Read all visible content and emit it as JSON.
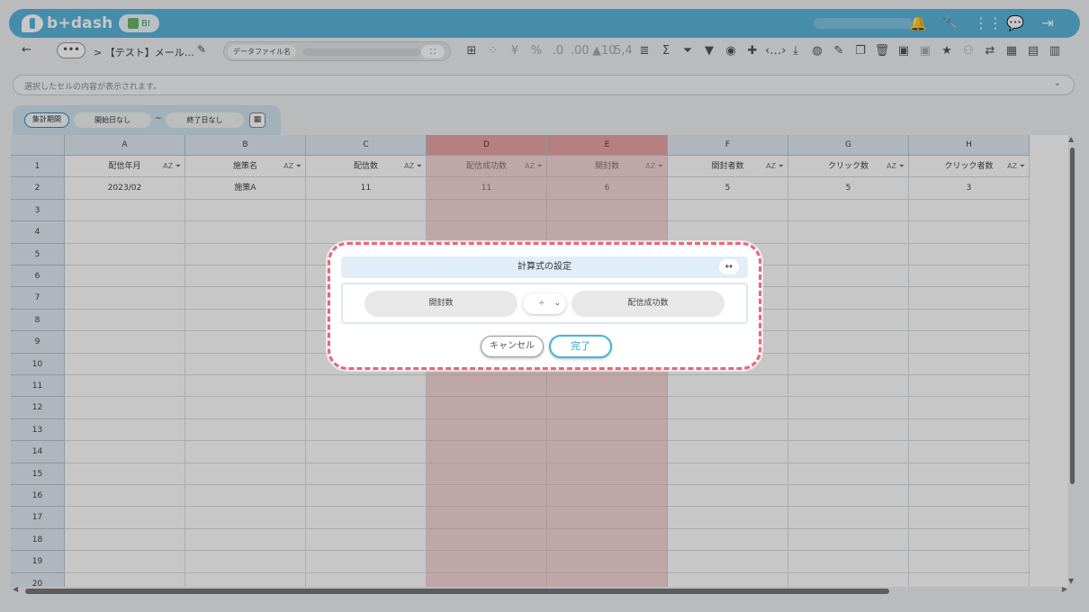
{
  "header": {
    "logo_text": "b+dash",
    "badge_text": "BI",
    "icons": [
      "bell-icon",
      "wrench-icon",
      "apps-grid-icon",
      "chat-icon",
      "logout-icon"
    ]
  },
  "toolbar": {
    "back_icon": "←",
    "more_label": "•••",
    "breadcrumb": "> 【テスト】メール…",
    "edit_icon": "✎",
    "datafile_label": "データファイル名",
    "expand_label": "⛶",
    "tool_icons": [
      {
        "name": "table-icon",
        "glyph": "⊞",
        "dim": false
      },
      {
        "name": "dotted-grid-icon",
        "glyph": "⁘",
        "dim": true
      },
      {
        "name": "yen-icon",
        "glyph": "¥",
        "dim": true
      },
      {
        "name": "percent-icon",
        "glyph": "%",
        "dim": true
      },
      {
        "name": "decimal-decrease-icon",
        "glyph": ".0",
        "dim": true
      },
      {
        "name": "decimal-increase-icon",
        "glyph": ".00",
        "dim": true
      },
      {
        "name": "sort-number-icon",
        "glyph": "▲10",
        "dim": true
      },
      {
        "name": "format-number-icon",
        "glyph": "5,4",
        "dim": true
      },
      {
        "name": "align-icon",
        "glyph": "≣",
        "dim": false
      },
      {
        "name": "sum-icon",
        "glyph": "Σ",
        "dim": false
      },
      {
        "name": "filter-clear-icon",
        "glyph": "⏷",
        "dim": false
      },
      {
        "name": "filter-icon",
        "glyph": "▼",
        "dim": false
      },
      {
        "name": "eye-icon",
        "glyph": "◉",
        "dim": false
      },
      {
        "name": "pin-icon",
        "glyph": "✚",
        "dim": false
      },
      {
        "name": "code-icon",
        "glyph": "‹…›",
        "dim": false
      },
      {
        "name": "download-icon",
        "glyph": "⤓",
        "dim": false
      },
      {
        "name": "chart-icon",
        "glyph": "◍",
        "dim": false
      },
      {
        "name": "edit-note-icon",
        "glyph": "✎",
        "dim": false
      },
      {
        "name": "copy-icon",
        "glyph": "❐",
        "dim": false
      },
      {
        "name": "trash-icon",
        "glyph": "🗑",
        "dim": false
      },
      {
        "name": "archive-icon",
        "glyph": "▣",
        "dim": false
      },
      {
        "name": "archive-dim-icon",
        "glyph": "▣",
        "dim": true
      },
      {
        "name": "star-icon",
        "glyph": "★",
        "dim": false
      },
      {
        "name": "user-check-icon",
        "glyph": "⚇",
        "dim": true
      },
      {
        "name": "repeat-icon",
        "glyph": "⇄",
        "dim": false
      },
      {
        "name": "calendar-icon",
        "glyph": "▦",
        "dim": false
      },
      {
        "name": "document-icon",
        "glyph": "▤",
        "dim": false
      },
      {
        "name": "clipboard-icon",
        "glyph": "▥",
        "dim": false
      }
    ]
  },
  "selection_bar": {
    "placeholder": "選択したセルの内容が表示されます。",
    "chevron": "⌄"
  },
  "date_filter": {
    "period_label": "集計期間",
    "start_label": "開始日なし",
    "separator": "~",
    "end_label": "終了日なし",
    "calendar_icon": "▦"
  },
  "grid": {
    "column_letters": [
      "A",
      "B",
      "C",
      "D",
      "E",
      "F",
      "G",
      "H"
    ],
    "highlighted_columns": [
      "D",
      "E"
    ],
    "header_names": [
      "配信年月",
      "施策名",
      "配信数",
      "配信成功数",
      "開封数",
      "開封者数",
      "クリック数",
      "クリック者数"
    ],
    "header_controls": "AZ  ⏷",
    "rows": [
      {
        "num": "2",
        "cells": [
          "2023/02",
          "施策A",
          "11",
          "11",
          "6",
          "5",
          "5",
          "3"
        ]
      }
    ],
    "row_numbers": [
      "1",
      "2",
      "3",
      "4",
      "5",
      "6",
      "7",
      "8",
      "9",
      "10",
      "11",
      "12",
      "13",
      "14",
      "15",
      "16",
      "17",
      "18",
      "19",
      "20"
    ]
  },
  "dialog": {
    "title": "計算式の設定",
    "expand_icon": "↔",
    "left_operand": "開封数",
    "operator": "÷",
    "right_operand": "配信成功数",
    "cancel_label": "キャンセル",
    "done_label": "完了"
  },
  "colors": {
    "brand": "#5ab4dc",
    "highlight_column": "#e9a4a5",
    "dialog_border": "#e8667a",
    "done_button": "#42b6db"
  }
}
